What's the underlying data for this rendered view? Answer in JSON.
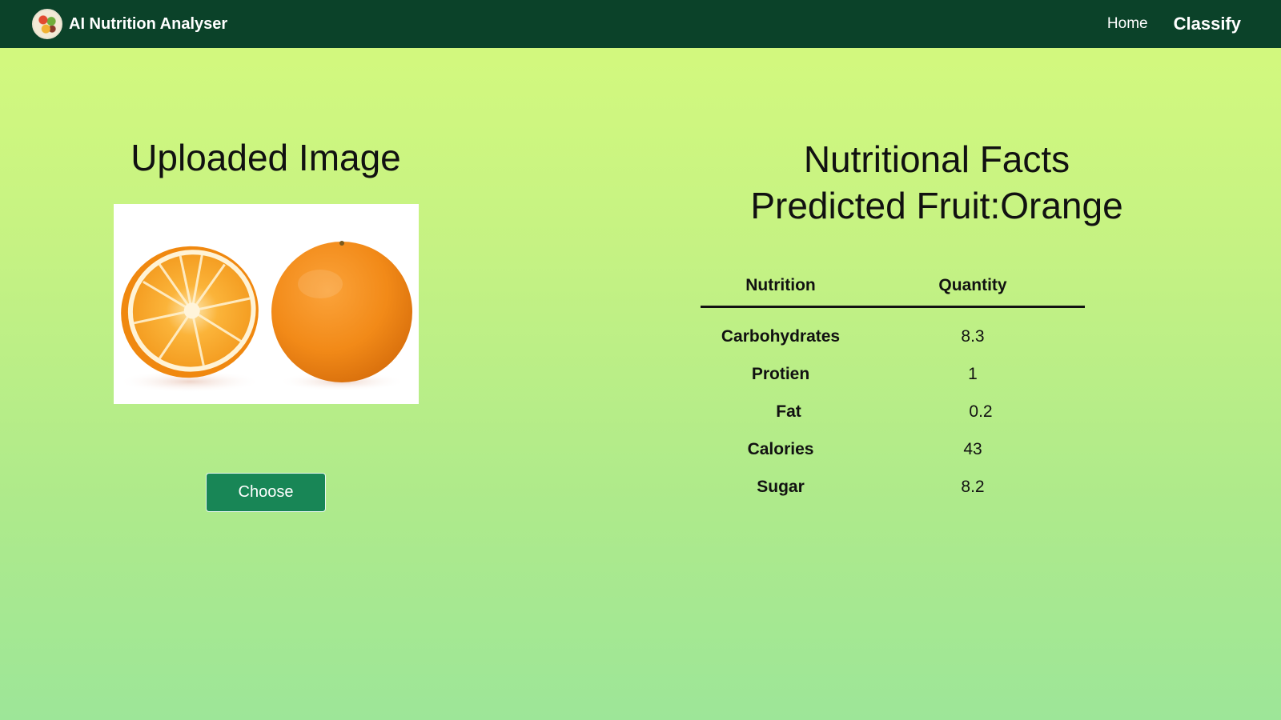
{
  "navbar": {
    "brand": "AI Nutrition Analyser",
    "links": {
      "home": "Home",
      "classify": "Classify"
    }
  },
  "upload": {
    "title": "Uploaded Image",
    "choose_label": "Choose"
  },
  "facts": {
    "title": "Nutritional Facts",
    "prediction": "Predicted Fruit:Orange",
    "columns": [
      "Nutrition",
      "Quantity"
    ],
    "rows": [
      {
        "name": "Carbohydrates",
        "quantity": "8.3"
      },
      {
        "name": "Protien",
        "quantity": "1"
      },
      {
        "name": "Fat",
        "quantity": "0.2"
      },
      {
        "name": "Calories",
        "quantity": "43"
      },
      {
        "name": "Sugar",
        "quantity": "8.2"
      }
    ]
  },
  "colors": {
    "navbar": "#0b4229",
    "button": "#188656",
    "background_top": "#d6fa7d",
    "background_bottom": "#9de698"
  }
}
